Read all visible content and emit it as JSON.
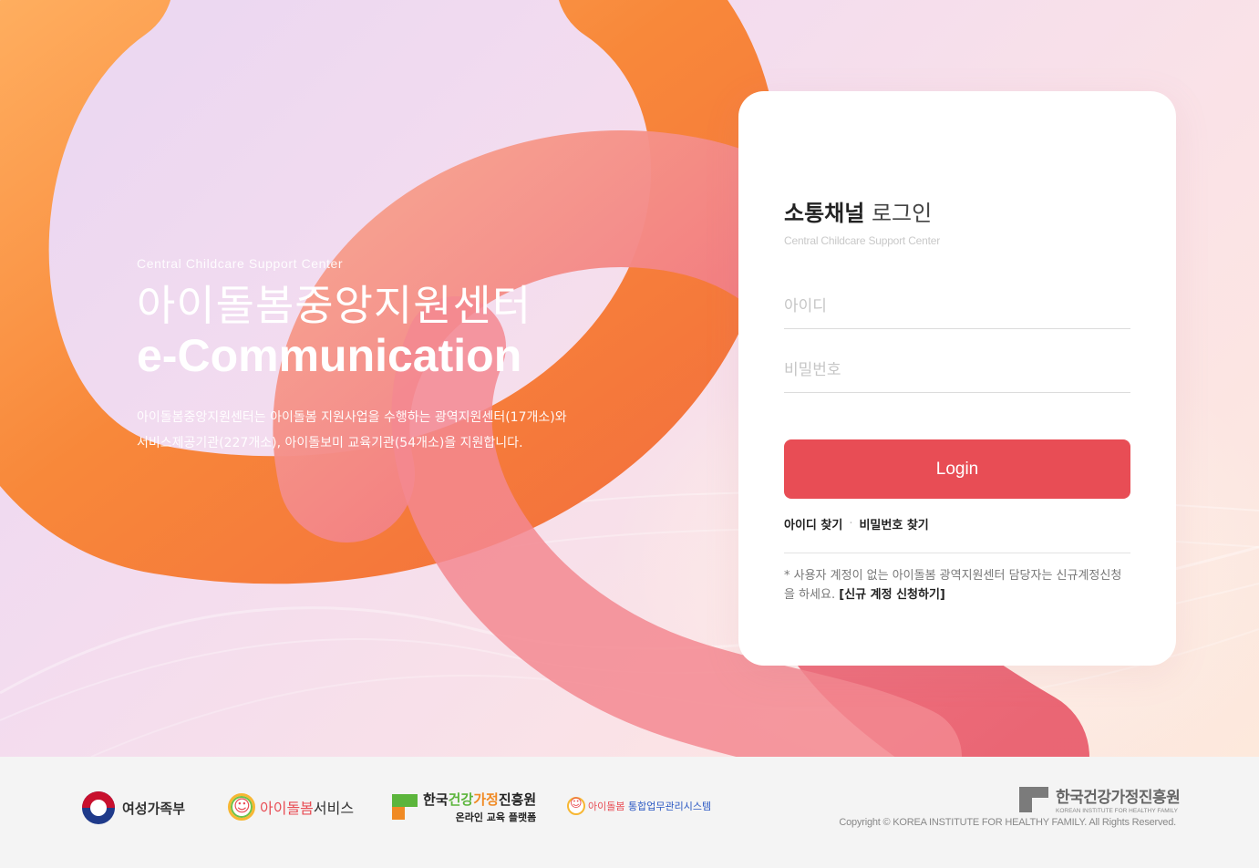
{
  "hero": {
    "subtitle": "Central Childcare Support Center",
    "title_ko": "아이돌봄중앙지원센터",
    "title_en": "e-Communication",
    "desc_line1": "아이돌봄중앙지원센터는 아이돌봄 지원사업을 수행하는 광역지원센터(17개소)와",
    "desc_line2": "서비스제공기관(227개소), 아이돌보미 교육기관(54개소)을 지원합니다."
  },
  "login": {
    "title_bold": "소통채널",
    "title_light": "로그인",
    "subtitle": "Central Childcare Support Center",
    "id_placeholder": "아이디",
    "pw_placeholder": "비밀번호",
    "button_label": "Login",
    "find_id": "아이디 찾기",
    "find_pw": "비밀번호 찾기",
    "separator": "·",
    "notice_text": "* 사용자 계정이 없는 아이돌봄 광역지원센터 담당자는 신규계정신청을 하세요.",
    "notice_link": "[신규 계정 신청하기]"
  },
  "footer": {
    "mogef": "여성가족부",
    "idol_a": "아이돌봄",
    "idol_b": "서비스",
    "edu_a": "한국",
    "edu_b": "건강",
    "edu_c": "가정",
    "edu_d": "진흥원",
    "edu_sub": "온라인 교육 플랫폼",
    "sys_a": "아이돌봄",
    "sys_b": "통합업무관리시스템",
    "kihf_ko": "한국건강가정진흥원",
    "kihf_en": "KOREAN INSTITUTE FOR HEALTHY FAMILY",
    "copyright": "Copyright © KOREA INSTITUTE FOR HEALTHY FAMILY. All Rights Reserved."
  },
  "colors": {
    "accent": "#e84d55",
    "ring_orange": "#f7933c",
    "ring_pink": "#f0707a"
  }
}
